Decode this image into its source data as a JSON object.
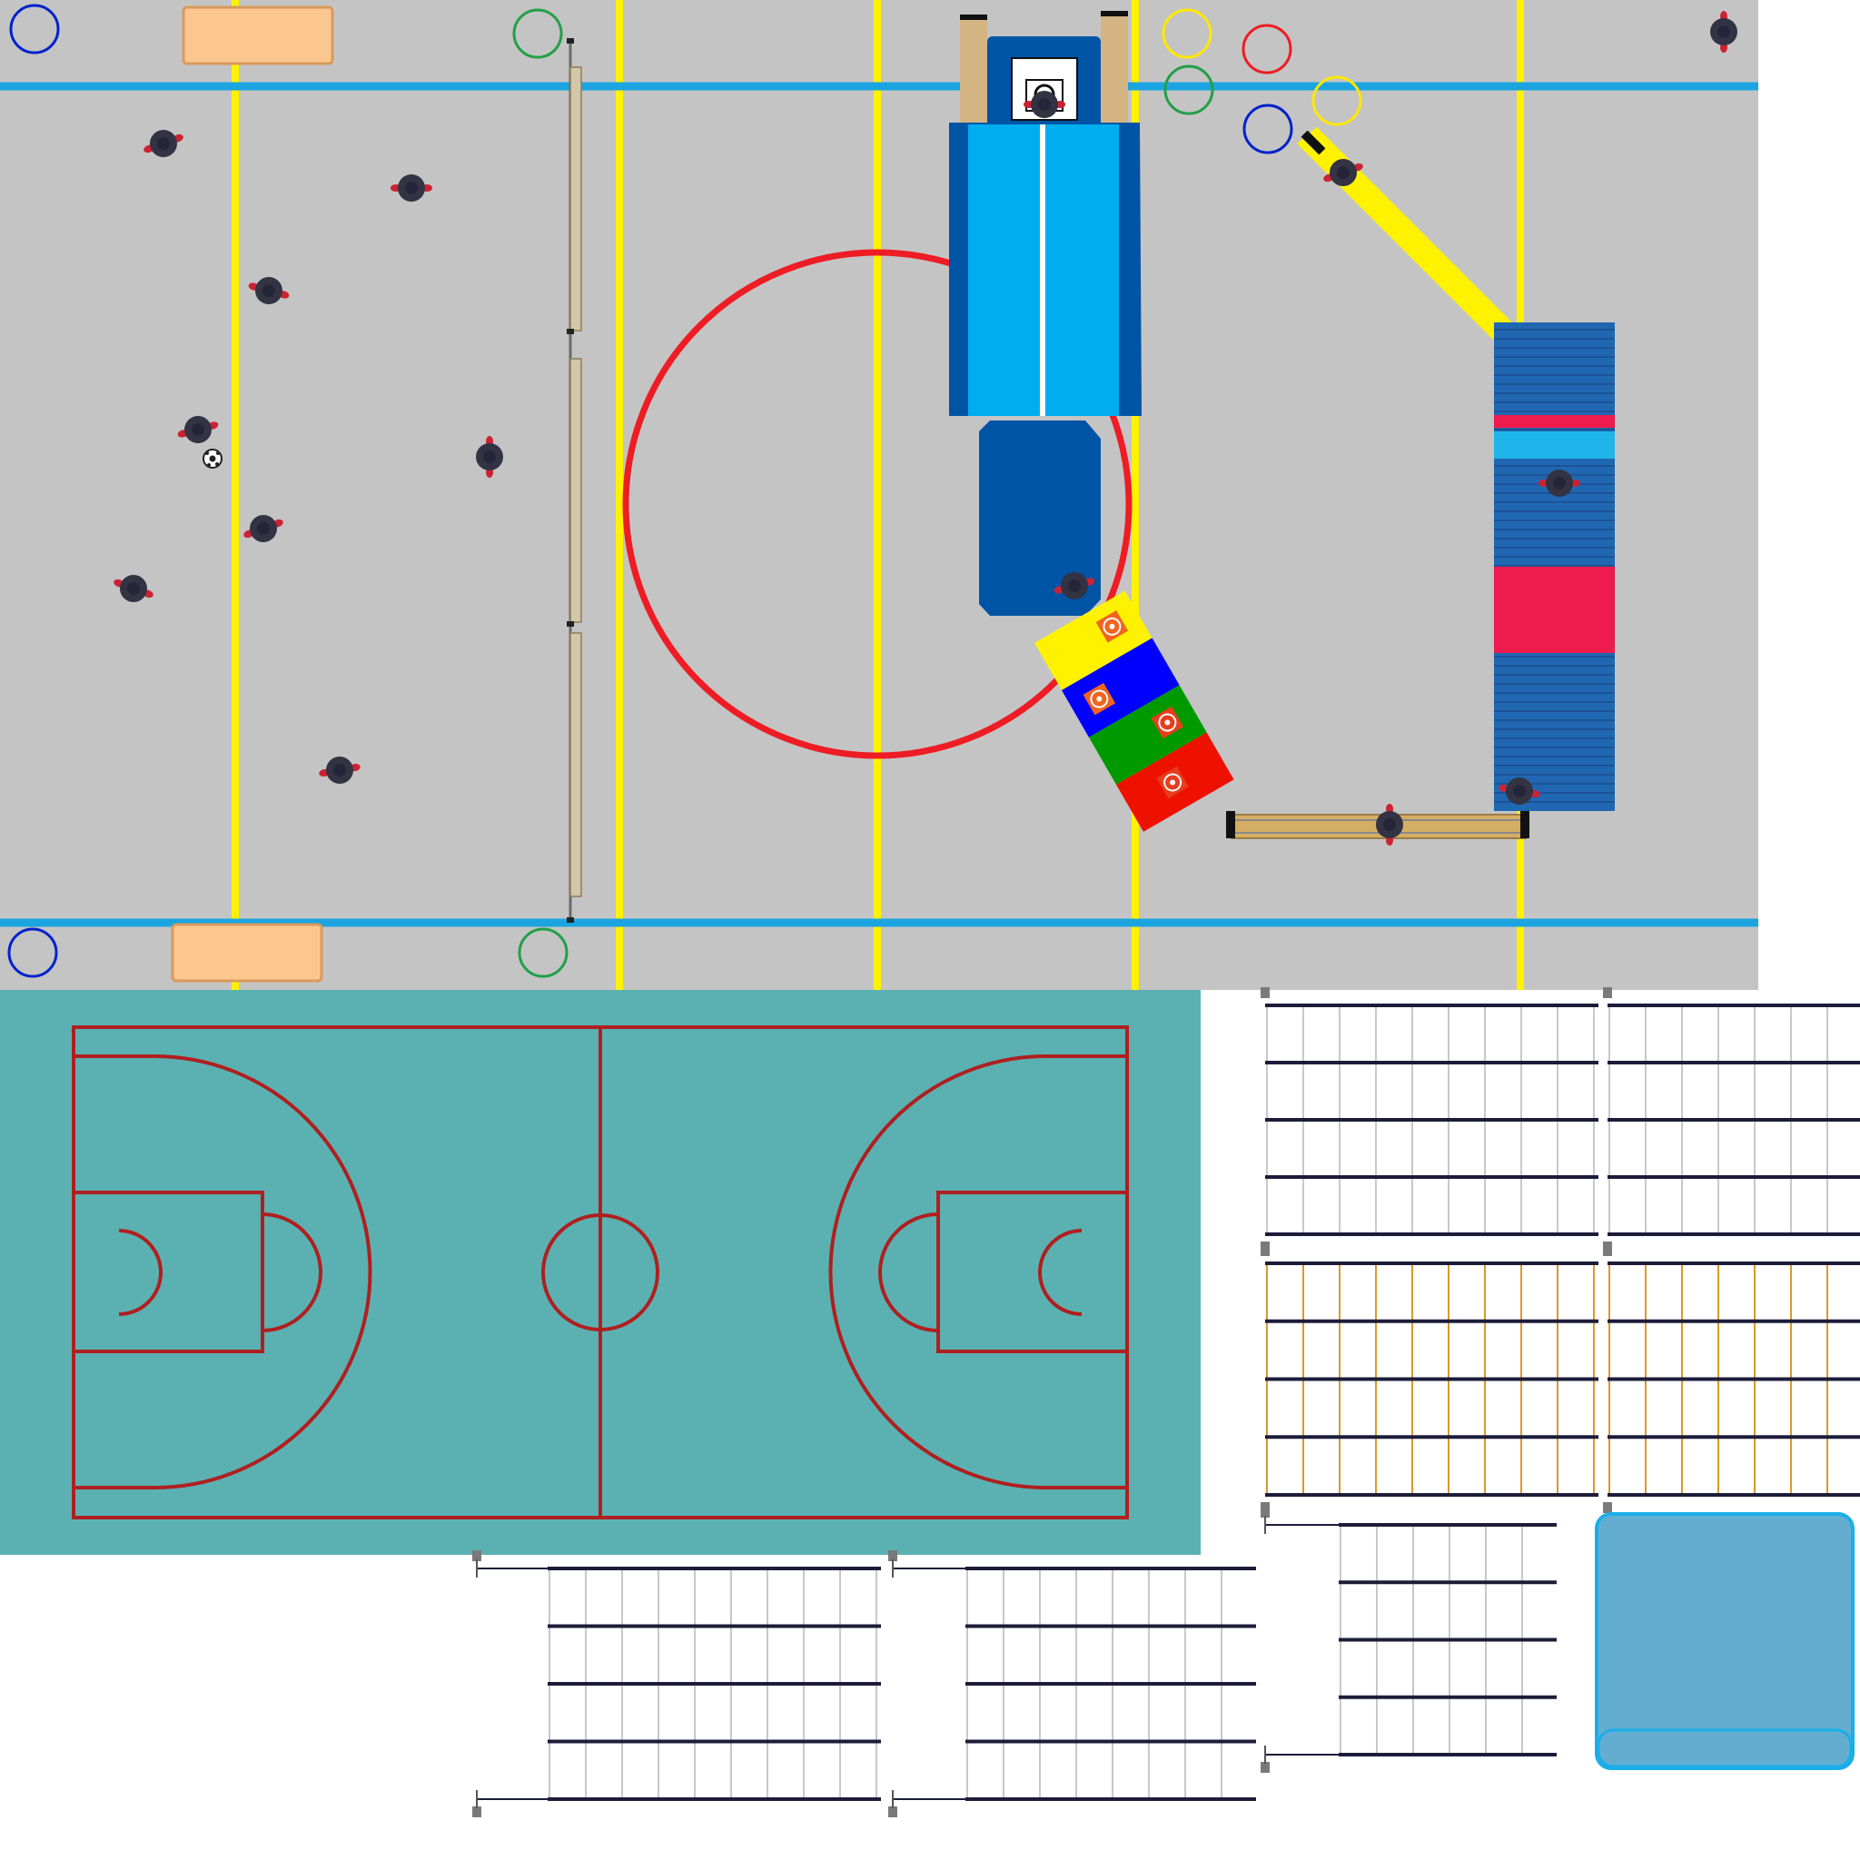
{
  "canvas": {
    "background": "#ffffff"
  },
  "colors": {
    "gym_floor": "#c4c4c4",
    "boundary_line": "#1ba4e0",
    "yellow_line": "#fff200",
    "center_circle": "#ee1c24",
    "bench_pad": "#fcc78e",
    "mat_light_blue": "#00aeef",
    "mat_dark_blue": "#0054a6",
    "wedge_ramp": "#fff200",
    "court_surface": "#5bb1b2",
    "court_lines": "#b01f1f",
    "stand_rail_dark": "#1c1c3a",
    "stand_rail_grey": "#c8c8c8",
    "stand_rail_orange": "#d99a2b",
    "pool_blue": "#63aed0",
    "pool_edge": "#19aee9",
    "person_body": "#333344",
    "person_accent": "#cc2233"
  },
  "gym": {
    "marker_rings": [
      {
        "name": "marker-ring-blue",
        "color": "#0022cc"
      },
      {
        "name": "marker-ring-green",
        "color": "#22a048"
      },
      {
        "name": "marker-ring-yellow",
        "color": "#ffe800"
      },
      {
        "name": "marker-ring-red",
        "color": "#ee1c24"
      }
    ],
    "step_box_colors": [
      "#fff200",
      "#0000ff",
      "#009900",
      "#ee1100"
    ],
    "stacked_mat_stripes": [
      "#ee1c4c",
      "#1fb5ea",
      "#ee1c4c"
    ],
    "icons": [
      "person-icon",
      "soccer-ball-icon",
      "basketball-hoop-icon",
      "target-icon"
    ]
  },
  "sections": [
    {
      "name": "gymnasium-floor"
    },
    {
      "name": "basketball-court"
    },
    {
      "name": "bleacher-stands"
    },
    {
      "name": "pool"
    }
  ]
}
